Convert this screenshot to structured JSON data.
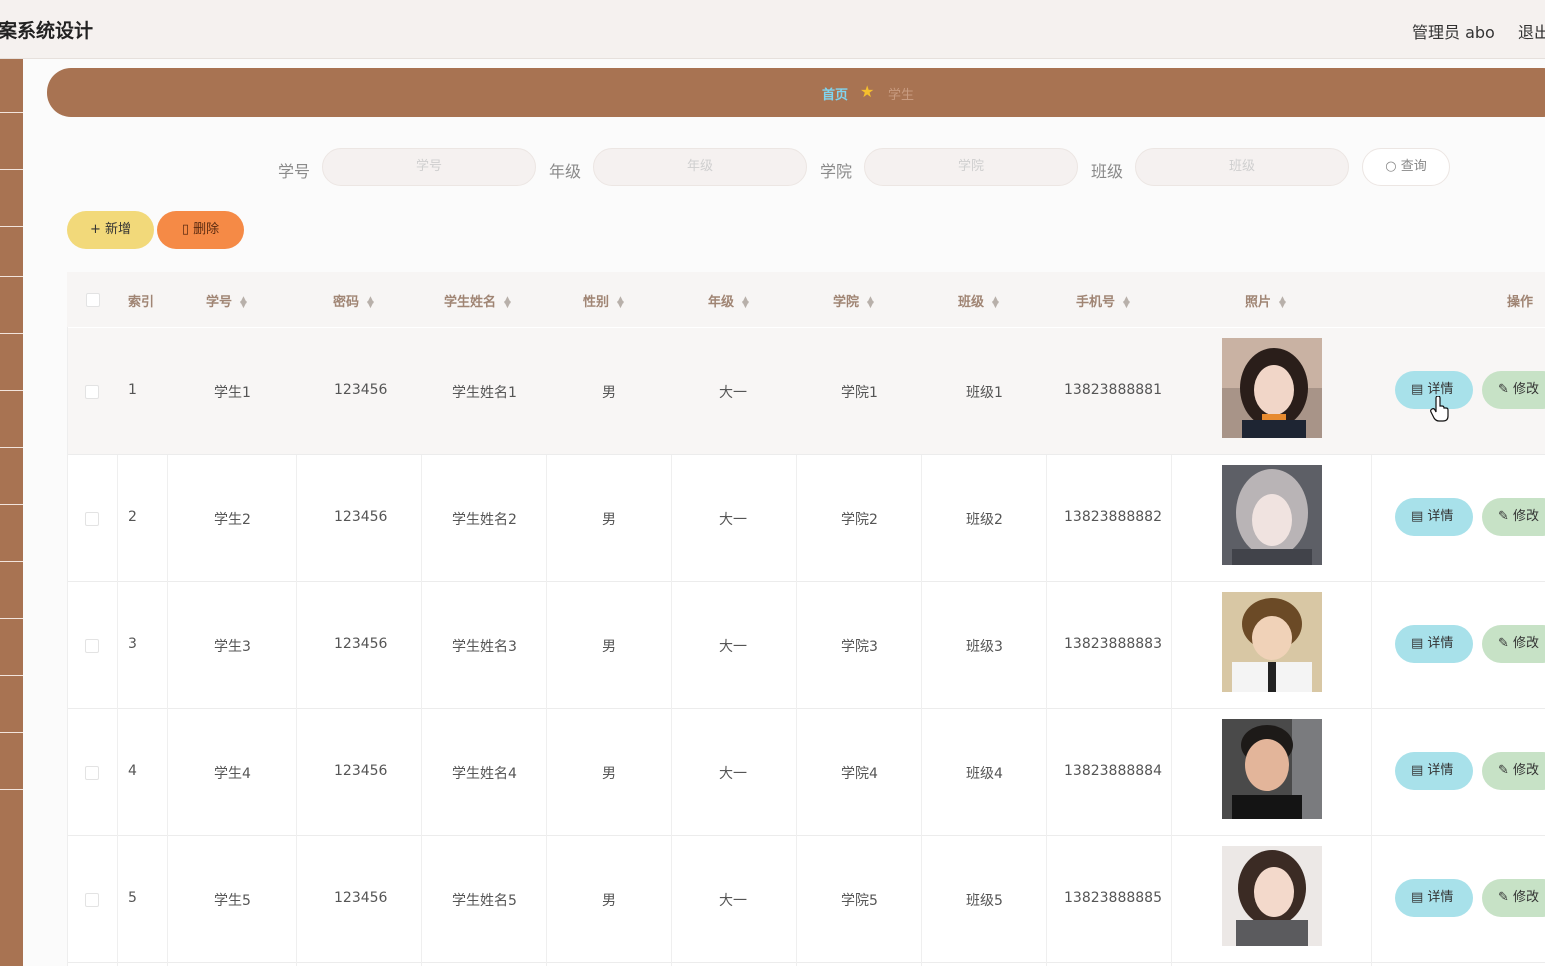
{
  "header": {
    "title": "案系统设计",
    "admin": "管理员 abo",
    "logout": "退出"
  },
  "breadcrumb": {
    "home": "首页",
    "current": "学生"
  },
  "search": {
    "fields": [
      {
        "label": "学号",
        "placeholder": "学号"
      },
      {
        "label": "年级",
        "placeholder": "年级"
      },
      {
        "label": "学院",
        "placeholder": "学院"
      },
      {
        "label": "班级",
        "placeholder": "班级"
      }
    ],
    "query": "查询"
  },
  "toolbar": {
    "add": "新增",
    "delete": "删除"
  },
  "table": {
    "columns": [
      "索引",
      "学号",
      "密码",
      "学生姓名",
      "性别",
      "年级",
      "学院",
      "班级",
      "手机号",
      "照片",
      "操作"
    ],
    "rows": [
      {
        "index": "1",
        "student_no": "学生1",
        "password": "123456",
        "name": "学生姓名1",
        "gender": "男",
        "grade": "大一",
        "college": "学院1",
        "class": "班级1",
        "phone": "13823888881"
      },
      {
        "index": "2",
        "student_no": "学生2",
        "password": "123456",
        "name": "学生姓名2",
        "gender": "男",
        "grade": "大一",
        "college": "学院2",
        "class": "班级2",
        "phone": "13823888882"
      },
      {
        "index": "3",
        "student_no": "学生3",
        "password": "123456",
        "name": "学生姓名3",
        "gender": "男",
        "grade": "大一",
        "college": "学院3",
        "class": "班级3",
        "phone": "13823888883"
      },
      {
        "index": "4",
        "student_no": "学生4",
        "password": "123456",
        "name": "学生姓名4",
        "gender": "男",
        "grade": "大一",
        "college": "学院4",
        "class": "班级4",
        "phone": "13823888884"
      },
      {
        "index": "5",
        "student_no": "学生5",
        "password": "123456",
        "name": "学生姓名5",
        "gender": "男",
        "grade": "大一",
        "college": "学院5",
        "class": "班级5",
        "phone": "13823888885"
      }
    ],
    "actions": {
      "detail": "详情",
      "edit": "修改"
    }
  },
  "colors": {
    "brand": "#a87352",
    "add": "#f2d97a",
    "delete": "#f58a46",
    "detail": "#a8e1ea",
    "edit": "#c7e2c6"
  }
}
